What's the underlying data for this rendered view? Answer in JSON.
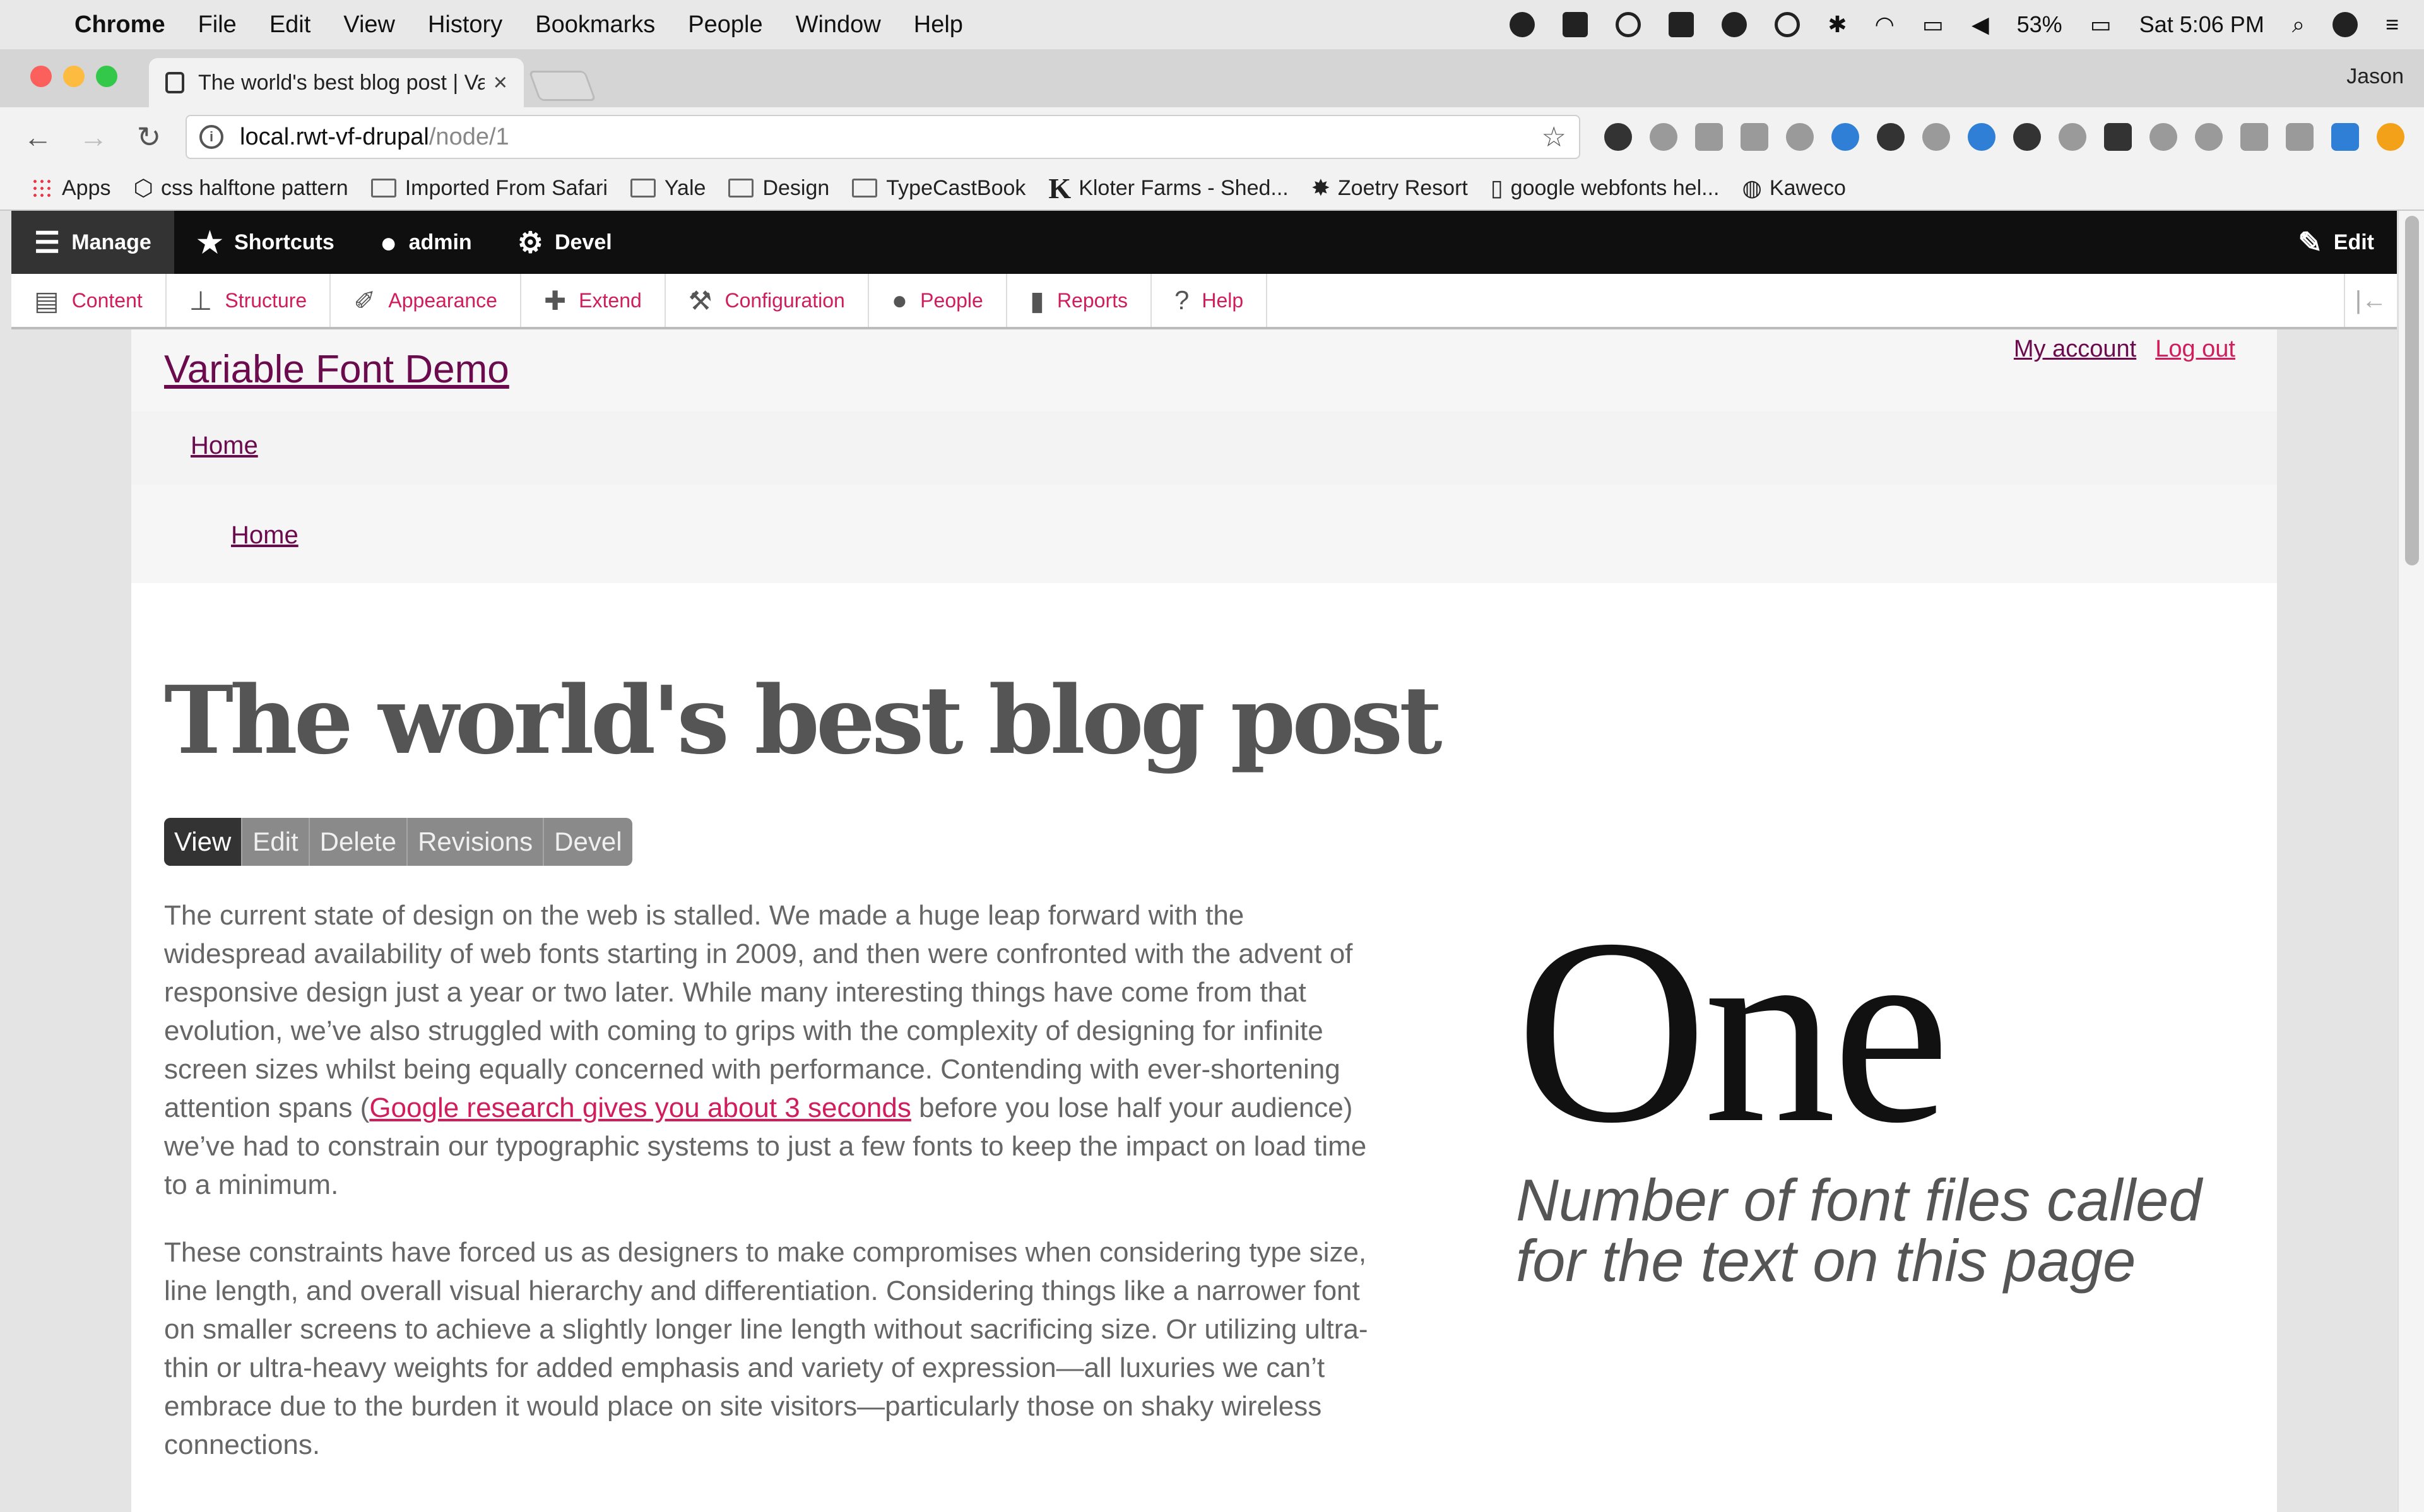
{
  "menubar": {
    "app_name": "Chrome",
    "items": [
      "File",
      "Edit",
      "View",
      "History",
      "Bookmarks",
      "People",
      "Window",
      "Help"
    ],
    "battery": "53%",
    "clock": "Sat 5:06 PM"
  },
  "browser": {
    "tab_title": "The world's best blog post | Va",
    "profile": "Jason",
    "url_host": "local.rwt-vf-drupal",
    "url_path": "/node/1",
    "bookmarks": [
      "Apps",
      "css halftone pattern",
      "Imported From Safari",
      "Yale",
      "Design",
      "TypeCastBook",
      "Kloter Farms - Shed...",
      "Zoetry Resort",
      "google webfonts hel...",
      "Kaweco"
    ]
  },
  "admin_toolbar": {
    "manage": "Manage",
    "shortcuts": "Shortcuts",
    "user": "admin",
    "devel": "Devel",
    "edit": "Edit",
    "tray": [
      "Content",
      "Structure",
      "Appearance",
      "Extend",
      "Configuration",
      "People",
      "Reports",
      "Help"
    ]
  },
  "site": {
    "name": "Variable Font Demo",
    "user_links": {
      "account": "My account",
      "logout": "Log out"
    },
    "main_nav_home": "Home",
    "breadcrumb_home": "Home"
  },
  "node": {
    "title": "The world's best blog post",
    "tasks": [
      "View",
      "Edit",
      "Delete",
      "Revisions",
      "Devel"
    ],
    "p1_before": "The current state of design on the web is stalled. We made a huge leap forward with the widespread availability of web fonts starting in 2009, and then were confronted with the advent of responsive design just a year or two later. While many interesting things have come from that evolution, we’ve also struggled with coming to grips with the complexity of designing for infinite screen sizes whilst being equally concerned with performance. Contending with ever-shortening attention spans (",
    "p1_link": "Google research gives you about 3 seconds",
    "p1_after": " before you lose half your audience) we’ve had to constrain our typographic systems to just a few fonts to keep the impact on load time to a minimum.",
    "p2": "These constraints have forced us as designers to make compromises when considering type size, line length, and overall visual hierarchy and differentiation. Considering things like a narrower font on smaller screens to achieve a slightly longer line length without sacrificing size. Or utilizing ultra-thin or ultra-heavy weights for added emphasis and variety of expression—all luxuries we can’t embrace due to the burden it would place on site visitors—particularly those on shaky wireless connections.",
    "stat_number": "One",
    "stat_caption": "Number of font files called for the text on this page"
  }
}
